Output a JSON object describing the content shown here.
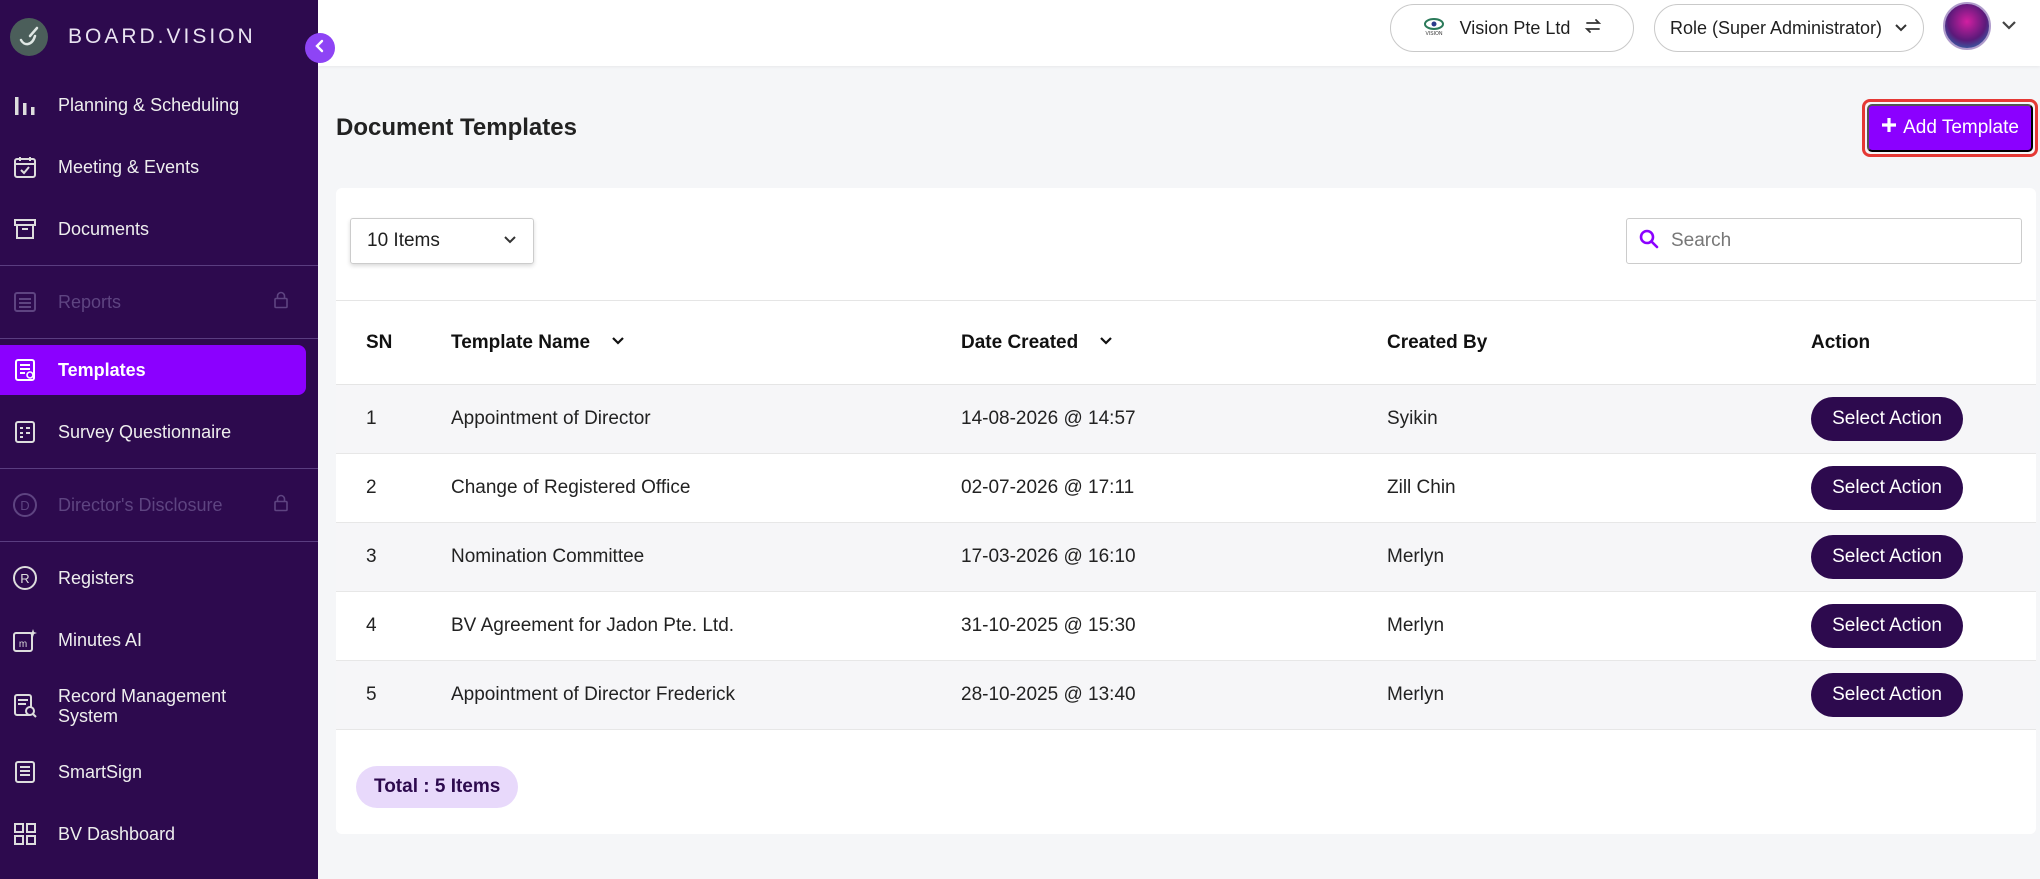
{
  "brand": {
    "name": "BOARD.VISION"
  },
  "sidebar": {
    "items": [
      {
        "label": "Planning & Scheduling",
        "icon": "bar-chart-icon"
      },
      {
        "label": "Meeting & Events",
        "icon": "calendar-check-icon"
      },
      {
        "label": "Documents",
        "icon": "archive-box-icon"
      },
      {
        "label": "Reports",
        "icon": "list-icon",
        "locked": true
      },
      {
        "label": "Templates",
        "icon": "template-icon",
        "active": true
      },
      {
        "label": "Survey Questionnaire",
        "icon": "checklist-icon"
      },
      {
        "label": "Director's Disclosure",
        "icon": "circle-d-icon",
        "locked": true
      },
      {
        "label": "Registers",
        "icon": "circle-r-icon"
      },
      {
        "label": "Minutes AI",
        "icon": "minutes-ai-icon"
      },
      {
        "label": "Record Management System",
        "icon": "record-search-icon"
      },
      {
        "label": "SmartSign",
        "icon": "document-sign-icon"
      },
      {
        "label": "BV Dashboard",
        "icon": "grid-icon"
      }
    ]
  },
  "topbar": {
    "org": "Vision Pte Ltd",
    "role": "Role (Super Administrator)"
  },
  "page": {
    "title": "Document Templates",
    "add_button": "Add Template"
  },
  "controls": {
    "items_per_page": "10 Items",
    "search_placeholder": "Search"
  },
  "table": {
    "headers": {
      "sn": "SN",
      "name": "Template Name",
      "date": "Date Created",
      "by": "Created By",
      "action": "Action"
    },
    "rows": [
      {
        "sn": "1",
        "name": "Appointment of Director",
        "date": "14-08-2026 @ 14:57",
        "by": "Syikin",
        "action": "Select Action"
      },
      {
        "sn": "2",
        "name": "Change of Registered Office",
        "date": "02-07-2026 @ 17:11",
        "by": "Zill Chin",
        "action": "Select Action"
      },
      {
        "sn": "3",
        "name": "Nomination Committee",
        "date": "17-03-2026 @ 16:10",
        "by": "Merlyn",
        "action": "Select Action"
      },
      {
        "sn": "4",
        "name": "BV Agreement for Jadon Pte. Ltd.",
        "date": "31-10-2025 @ 15:30",
        "by": "Merlyn",
        "action": "Select Action"
      },
      {
        "sn": "5",
        "name": "Appointment of Director Frederick",
        "date": "28-10-2025 @ 13:40",
        "by": "Merlyn",
        "action": "Select Action"
      }
    ]
  },
  "footer": {
    "total": "Total : 5 Items"
  },
  "colors": {
    "sidebar": "#2d0a4e",
    "accent": "#8b00ff",
    "action_button": "#2d0a4e",
    "total_badge": "#e8d9fb"
  }
}
